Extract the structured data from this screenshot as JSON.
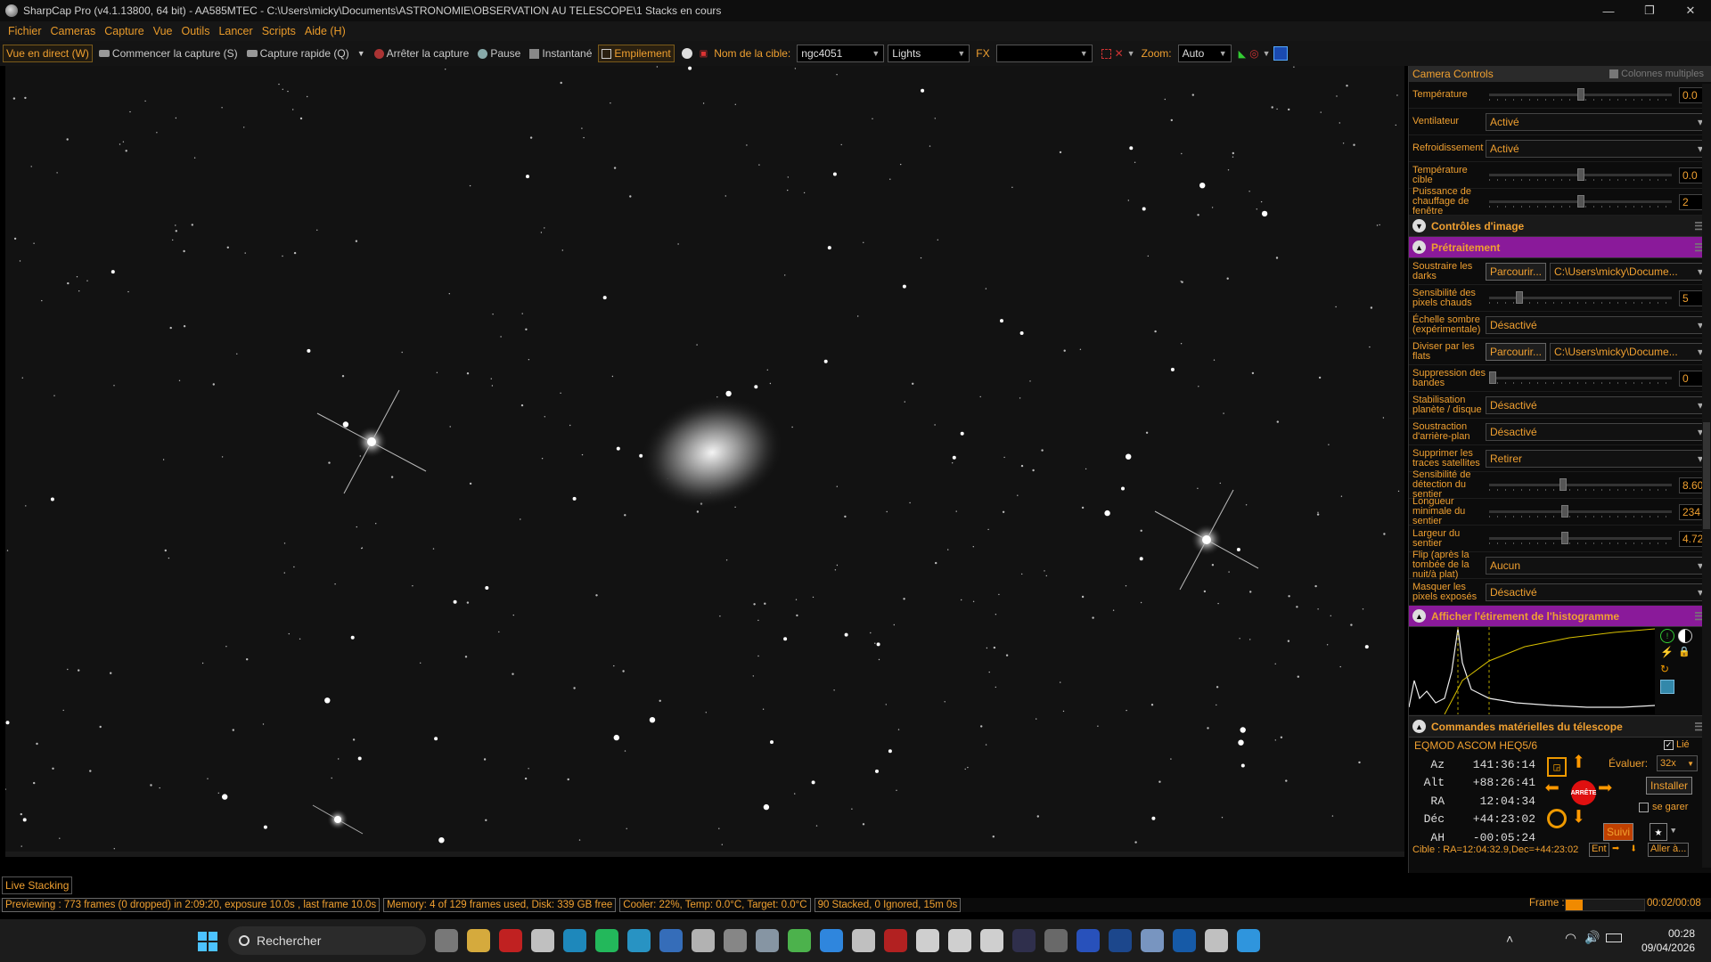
{
  "window": {
    "title": "SharpCap Pro (v4.1.13800, 64 bit) - AA585MTEC - C:\\Users\\micky\\Documents\\ASTRONOMIE\\OBSERVATION AU TELESCOPE\\1 Stacks en cours",
    "minimize": "—",
    "maximize": "❐",
    "close": "✕"
  },
  "menu": [
    "Fichier",
    "Cameras",
    "Capture",
    "Vue",
    "Outils",
    "Lancer",
    "Scripts",
    "Aide (H)"
  ],
  "toolbar": {
    "live_view": "Vue en direct (W)",
    "start_capture": "Commencer la capture (S)",
    "quick_capture": "Capture rapide (Q)",
    "stop_capture": "Arrêter la capture",
    "pause": "Pause",
    "snapshot": "Instantané",
    "stacking": "Empilement",
    "target_label": "Nom de la cible:",
    "target_value": "ngc4051",
    "frame_type": "Lights",
    "fx_label": "FX",
    "fx_value": "",
    "zoom_label": "Zoom:",
    "zoom_value": "Auto"
  },
  "panel": {
    "header": "Camera Controls",
    "multi_columns": "Colonnes multiples",
    "camera_rows": [
      {
        "label": "Température",
        "type": "slider",
        "value": "0.0",
        "pos": 0.5
      },
      {
        "label": "Ventilateur",
        "type": "select",
        "value": "Activé"
      },
      {
        "label": "Refroidissement",
        "type": "select",
        "value": "Activé"
      },
      {
        "label": "Température cible",
        "type": "slider",
        "value": "0.0",
        "pos": 0.5
      },
      {
        "label": "Puissance de chauffage de fenêtre",
        "type": "slider",
        "value": "2",
        "pos": 0.5
      }
    ],
    "image_controls": "Contrôles d'image",
    "preprocessing": "Prétraitement",
    "browse": "Parcourir...",
    "path": "C:\\Users\\micky\\Docume...",
    "pre_rows": [
      {
        "label": "Soustraire les darks",
        "type": "browse"
      },
      {
        "label": "Sensibilité des pixels chauds",
        "type": "slider",
        "value": "5",
        "pos": 0.15
      },
      {
        "label": "Échelle sombre (expérimentale)",
        "type": "select",
        "value": "Désactivé"
      },
      {
        "label": "Diviser par les flats",
        "type": "browse"
      },
      {
        "label": "Suppression des bandes",
        "type": "slider",
        "value": "0",
        "pos": 0.0
      },
      {
        "label": "Stabilisation planète / disque",
        "type": "select",
        "value": "Désactivé"
      },
      {
        "label": "Soustraction d'arrière-plan",
        "type": "select",
        "value": "Désactivé"
      },
      {
        "label": "Supprimer les traces satellites",
        "type": "select",
        "value": "Retirer"
      },
      {
        "label": "Sensibilité de détection du sentier",
        "type": "slider",
        "value": "8.60",
        "pos": 0.4
      },
      {
        "label": "Longueur minimale du sentier",
        "type": "slider",
        "value": "234",
        "pos": 0.41
      },
      {
        "label": "Largeur du sentier",
        "type": "slider",
        "value": "4.72",
        "pos": 0.41
      },
      {
        "label": "Flip (après la tombée de la nuit/à plat)",
        "type": "select",
        "value": "Aucun"
      },
      {
        "label": "Masquer les pixels exposés",
        "type": "select",
        "value": "Désactivé"
      }
    ],
    "histogram_title": "Afficher l'étirement de l'histogramme",
    "telescope_title": "Commandes matérielles du télescope",
    "mount_name": "EQMOD ASCOM HEQ5/6",
    "linked": "Lié",
    "rate_label": "Évaluer:",
    "rate_value": "32x",
    "stop": "ARRÊTE",
    "install": "Installer",
    "park": "se garer",
    "tracking": "Suivi",
    "goto": "Aller à...",
    "target_line": "Cible : RA=12:04:32.9,Dec=+44:23:02",
    "target_btn": "Ent",
    "coords": [
      {
        "k": "Az",
        "v": "141:36:14"
      },
      {
        "k": "Alt",
        "v": "+88:26:41"
      },
      {
        "k": "RA",
        "v": "12:04:34"
      },
      {
        "k": "Déc",
        "v": "+44:23:02"
      },
      {
        "k": "AH",
        "v": "-00:05:24"
      }
    ]
  },
  "live_stacking": "Live Stacking",
  "status": {
    "preview": "Previewing : 773 frames (0 dropped) in 2:09:20, exposure 10.0s , last frame 10.0s",
    "memory": "Memory: 4 of 129 frames used, Disk: 339 GB free",
    "cooler": "Cooler: 22%, Temp: 0.0°C, Target: 0.0°C",
    "stacked": "90 Stacked, 0 Ignored, 15m 0s",
    "frame_label": "Frame :",
    "frame_progress": 0.22,
    "frame_time": "00:02/00:08"
  },
  "taskbar": {
    "search": "Rechercher",
    "time": "00:28",
    "date": "09/04/2026"
  },
  "colors": {
    "accent": "#f0a030",
    "purple": "#8a1a9a"
  }
}
